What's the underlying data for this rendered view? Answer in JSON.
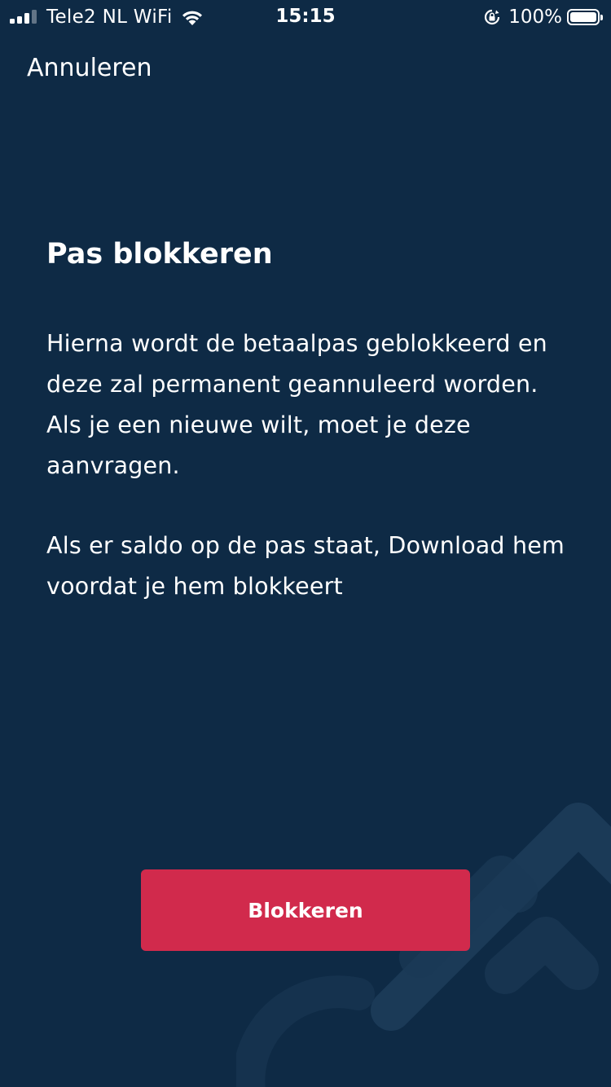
{
  "status_bar": {
    "carrier": "Tele2 NL WiFi",
    "time": "15:15",
    "battery": "100%",
    "battery_level": 1.0,
    "signal_bars_filled": 3,
    "signal_bars_total": 4,
    "icons": [
      "signal-icon",
      "wifi-icon",
      "rotation-lock-icon",
      "battery-icon"
    ]
  },
  "nav": {
    "cancel_label": "Annuleren"
  },
  "content": {
    "title": "Pas blokkeren",
    "paragraph_1": "Hierna wordt de betaalpas geblokkeerd en deze zal permanent geannuleerd worden. Als je een nieuwe wilt, moet je deze aanvragen.",
    "paragraph_2": "Als er saldo op de pas staat, Download hem voordat je hem blokkeert"
  },
  "action": {
    "button_label": "Blokkeren"
  },
  "colors": {
    "background": "#0e2a45",
    "accent": "#d12a4c",
    "text": "#ffffff"
  }
}
